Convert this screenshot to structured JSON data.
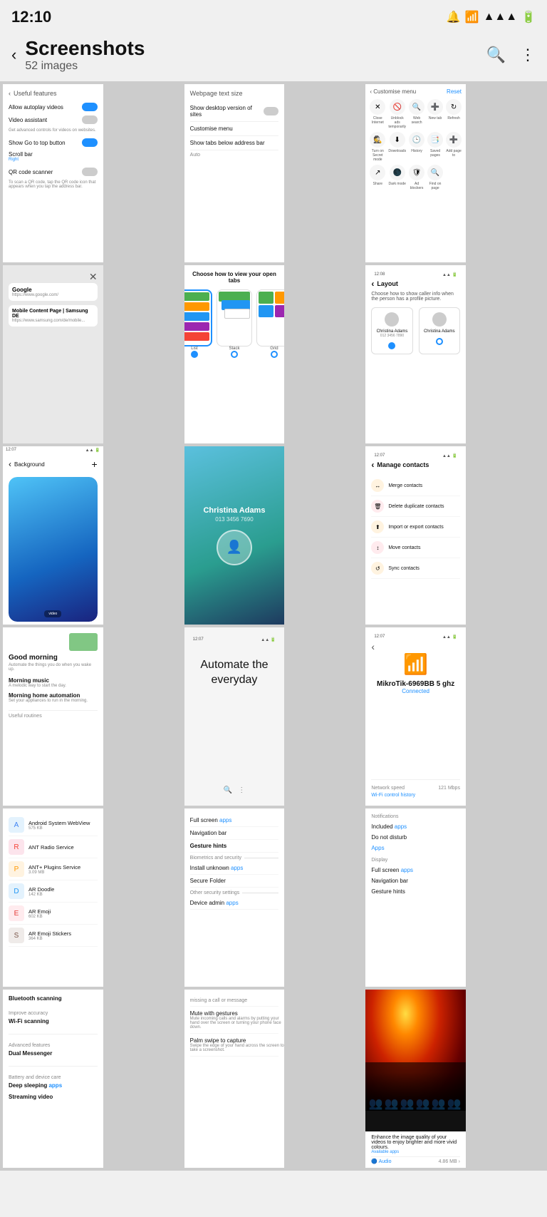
{
  "statusBar": {
    "time": "12:10",
    "icons": [
      "🔔",
      "📶",
      "🔋"
    ]
  },
  "header": {
    "title": "Screenshots",
    "subtitle": "52 images",
    "backLabel": "‹",
    "searchLabel": "🔍",
    "moreLabel": "⋮"
  },
  "cells": [
    {
      "id": "useful-features",
      "backText": "Useful features",
      "items": [
        {
          "title": "Allow autoplay videos",
          "hasToggle": true,
          "toggleOn": true
        },
        {
          "title": "Video assistant",
          "desc": "Get advanced controls for videos on websites.",
          "hasToggle": true,
          "toggleOn": false
        },
        {
          "title": "Show Go to top button",
          "hasToggle": true,
          "toggleOn": true
        },
        {
          "title": "Scroll bar",
          "subtext": "Right",
          "hasToggle": false
        },
        {
          "title": "QR code scanner",
          "desc": "To scan a QR code, tap the QR code icon that appears when you tap the address bar.",
          "hasToggle": true,
          "toggleOn": false
        }
      ]
    },
    {
      "id": "webpage-text",
      "title": "Webpage text size",
      "items": [
        {
          "label": "Show desktop version of sites",
          "hasToggle": true,
          "toggleOn": false
        },
        {
          "label": "Customise menu"
        },
        {
          "label": "Show tabs below address bar",
          "subtext": "Auto"
        }
      ]
    },
    {
      "id": "customise-menu",
      "backText": "Customise menu",
      "resetText": "Reset",
      "iconRows": [
        [
          {
            "icon": "✕",
            "label": "Close internet"
          },
          {
            "icon": "🚫",
            "label": "Unblock ads temporarily"
          },
          {
            "icon": "🔍",
            "label": "Web search"
          },
          {
            "icon": "➕",
            "label": "New tab"
          }
        ],
        [
          {
            "icon": "↻",
            "label": "Refresh"
          },
          {
            "icon": "🕵",
            "label": "Turn on Secret mode"
          }
        ],
        [
          {
            "icon": "⬇",
            "label": "Downloads"
          },
          {
            "icon": "🕒",
            "label": "History"
          },
          {
            "icon": "📑",
            "label": "Saved pages"
          },
          {
            "icon": "➕",
            "label": "Add page to"
          }
        ],
        [
          {
            "icon": "↗",
            "label": "Share"
          },
          {
            "icon": "🌑",
            "label": "Dark mode"
          },
          {
            "icon": "🛡",
            "label": "Ad blockers"
          },
          {
            "icon": "🔍",
            "label": "Find on page"
          }
        ]
      ]
    },
    {
      "id": "tabs-preview",
      "tabs": [
        {
          "title": "Google",
          "url": "https://www.google.com/"
        },
        {
          "title": "Mobile Content Page | Samsung DE",
          "url": "https://www.samsung.com/de/mobile..."
        }
      ]
    },
    {
      "id": "choose-tabs",
      "heading": "Choose how to view your open tabs",
      "options": [
        "List",
        "Stack",
        "Grid"
      ],
      "selectedIndex": 0
    },
    {
      "id": "layout",
      "navText": "Layout",
      "description": "Choose how to show caller info when the person has a profile picture.",
      "options": [
        {
          "name": "Christina Adams",
          "phone": "012 3456 7890",
          "selected": true
        },
        {
          "name": "Christina Adams",
          "phone": "",
          "selected": false
        }
      ]
    },
    {
      "id": "background",
      "miniStatus": "12:07",
      "navText": "Background",
      "videoBadge": "video"
    },
    {
      "id": "contact-card",
      "name": "Christina Adams",
      "phone": "013 3456 7690"
    },
    {
      "id": "manage-contacts",
      "miniStatus": "12:07",
      "navText": "Manage contacts",
      "options": [
        {
          "icon": "↔",
          "color": "#ff7043",
          "text": "Merge contacts"
        },
        {
          "icon": "🗑",
          "color": "#ef5350",
          "text": "Delete duplicate contacts"
        },
        {
          "icon": "⬆",
          "color": "#ff7043",
          "text": "Import or export contacts"
        },
        {
          "icon": "↕",
          "color": "#ef5350",
          "text": "Move contacts"
        },
        {
          "icon": "↺",
          "color": "#ff7043",
          "text": "Sync contacts"
        }
      ]
    },
    {
      "id": "routines",
      "decoPresent": true,
      "mainTitle": "Good morning",
      "mainSubtitle": "Automate the things you do when you wake up.",
      "items": [
        {
          "title": "Morning music",
          "desc": "A melodic way to start the day."
        },
        {
          "title": "Morning home automation",
          "desc": "Set your appliances to run in the morning."
        }
      ],
      "footerText": "Useful routines"
    },
    {
      "id": "automate",
      "title": "Automate the everyday"
    },
    {
      "id": "wifi",
      "miniStatus": "12:07",
      "wifiName": "MikroTik-6969BB 5 ghz",
      "status": "Connected",
      "speedLabel": "Network speed",
      "speedValue": "121 Mbps",
      "historyText": "Wi-Fi control history"
    },
    {
      "id": "apps-list",
      "apps": [
        {
          "name": "Android System WebView",
          "size": "575 KB",
          "color": "#4285f4",
          "icon": "A"
        },
        {
          "name": "ANT Radio Service",
          "size": "",
          "color": "#f44336",
          "icon": "R"
        },
        {
          "name": "ANT+ Plugins Service",
          "size": "3.09 MB",
          "color": "#ff9800",
          "icon": "P"
        },
        {
          "name": "AR Doodle",
          "size": "142 KB",
          "color": "#2196f3",
          "icon": "D"
        },
        {
          "name": "AR Emoji",
          "size": "602 KB",
          "color": "#e53935",
          "icon": "E"
        },
        {
          "name": "AR Emoji Stickers",
          "size": "364 KB",
          "color": "#795548",
          "icon": "S"
        }
      ]
    },
    {
      "id": "security-settings",
      "items": [
        {
          "label": "Full screen",
          "link": "apps"
        },
        {
          "label": "Navigation bar"
        },
        {
          "sublabel": "Gesture hints"
        },
        {
          "divider": "Biometrics and security"
        },
        {
          "label": "Install unknown",
          "link": "apps"
        },
        {
          "label": "Secure Folder"
        },
        {
          "divider": "Other security settings"
        },
        {
          "label": "Device admin",
          "link": "apps"
        }
      ]
    },
    {
      "id": "notifications-included",
      "sections": [
        {
          "title": "Notifications",
          "items": [
            {
              "text": "Included ",
              "link": "apps"
            },
            {
              "text": "Do not disturb"
            },
            {
              "subtext": "Apps",
              "isLink": true
            }
          ]
        },
        {
          "title": "Display",
          "items": [
            {
              "text": "Full screen ",
              "link": "apps"
            },
            {
              "text": "Navigation bar"
            },
            {
              "subtext": "Gesture hints"
            }
          ]
        }
      ]
    },
    {
      "id": "scanning",
      "items": [
        {
          "title": "Bluetooth scanning"
        },
        {
          "advLabel": "Improve accuracy"
        },
        {
          "title": "Wi-Fi scanning"
        }
      ],
      "advFeatures": "Advanced features",
      "dualMessenger": "Dual Messenger",
      "batterySection": "Battery and device care",
      "deepSleeping": "Deep sleeping ",
      "deepLink": "apps",
      "streamingLabel": "Streaming video"
    },
    {
      "id": "gestures",
      "missingCall": "missing a call or message",
      "items": [
        {
          "title": "Mute with gestures",
          "desc": "Mute incoming calls and alarms by putting your hand over the screen or turning your phone face down.",
          "hasToggle": true,
          "toggleOn": true
        },
        {
          "title": "Palm swipe to capture",
          "desc": "Swipe the edge of your hand across the screen to take a screenshot.",
          "hasToggle": true,
          "toggleOn": true
        }
      ]
    },
    {
      "id": "concert",
      "description": "Enhance the image quality of your videos to enjoy brighter and more vivid colours.",
      "linkText": "Available apps",
      "audioLabel": "Audio",
      "audioSize": "4.86 MB >"
    }
  ]
}
